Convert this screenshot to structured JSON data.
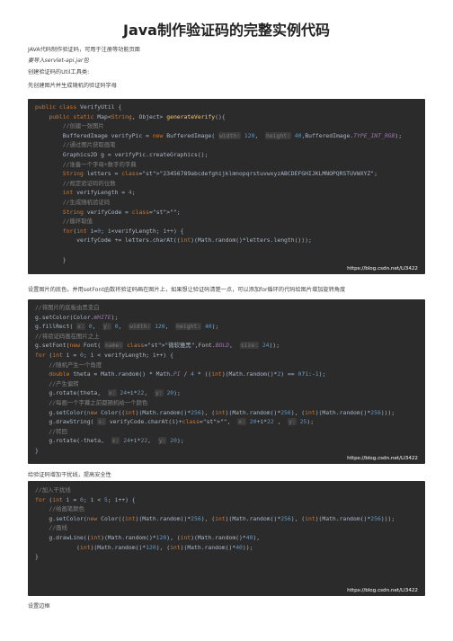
{
  "title": "Java制作验证码的完整实例代码",
  "paras": {
    "p1": "JAVA代码制作验证码，可用于注册等功能页面",
    "p2": "要导入servlet-api.jar包",
    "p3": "创建验证码的Util工具类:",
    "p4": "先创建图片并生成随机的验证码字母",
    "p5": "设置图片的底色，并用setFont函数将验证码画在图片上，如果想让验证码清楚一点，可以添加for循环的代码给图片增加旋转角度",
    "p6": "给验证码增加干扰线，提高安全性",
    "p7": "设置边框"
  },
  "watermark": "https://blog.csdn.net/LI3422",
  "code1": [
    "public class VerifyUtil {",
    "    public static Map<String, Object> generateVerify(){",
    "        //创建一张图片",
    "        BufferedImage verifyPic = new BufferedImage( width: 120,  height: 40,BufferedImage.TYPE_INT_RGB);",
    "        //通过图片获取画笔",
    "        Graphics2D g = verifyPic.createGraphics();",
    "        //准备一个字母+数字的字典",
    "        String letters = \"23456789abcdefghijklmnopqrstuvwxyzABCDEFGHIJKLMNOPQRSTUVWXYZ\";",
    "        //规定验证码的位数",
    "        int verifyLength = 4;",
    "        //生成随机验证码",
    "        String verifyCode = \"\";",
    "        //循环取值",
    "        for(int i=0; i<verifyLength; i++) {",
    "            verifyCode += letters.charAt((int)(Math.random()*letters.length()));",
    "",
    "        }"
  ],
  "code2": [
    "//将图片的底板由黑变白",
    "g.setColor(Color.WHITE);",
    "g.fillRect( x: 0,  y: 0,  width: 120,  height: 40);",
    "//将验证码画在图片之上",
    "g.setFont(new Font( name: \"微软雅黑\",Font.BOLD,  size: 24));",
    "for (int i = 0; i < verifyLength; i++) {",
    "    //随机产生一个角度",
    "    double theta = Math.random() * Math.PI / 4 * ((int)(Math.random()*2) == 0?1:-1);",
    "    //产生偏转",
    "    g.rotate(theta,  x: 24+i*22,  y: 20);",
    "    //每画一个字幕之前都随机给一个颜色",
    "    g.setColor(new Color((int)(Math.random()*256), (int)(Math.random()*256), (int)(Math.random()*256)));",
    "    g.drawString( s: verifyCode.charAt(i)+\"\",  x: 20+i*22 ,  y: 25);",
    "    //转回",
    "    g.rotate(-theta,  x: 24+i*22,  y: 20);",
    "}"
  ],
  "code3": [
    "//加入干扰线",
    "for (int i = 0; i < 5; i++) {",
    "    //给画笔颜色",
    "    g.setColor(new Color((int)(Math.random()*256), (int)(Math.random()*256), (int)(Math.random()*256)));",
    "    //画线",
    "    g.drawLine((int)(Math.random()*120), (int)(Math.random()*40),",
    "            (int)(Math.random()*120), (int)(Math.random()*40));",
    "}"
  ]
}
